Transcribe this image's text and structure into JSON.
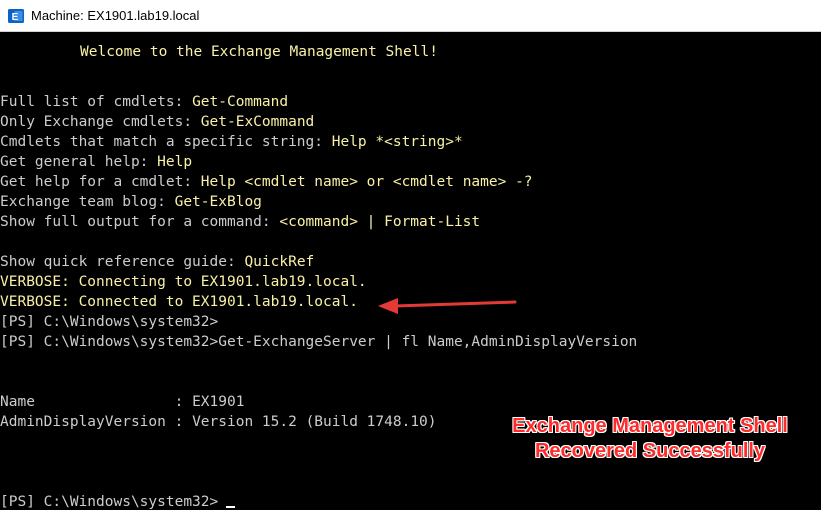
{
  "window": {
    "title": "Machine: EX1901.lab19.local",
    "icon": "exchange-shell-icon",
    "brand_color": "#0a64c8"
  },
  "console": {
    "welcome": "Welcome to the Exchange Management Shell!",
    "help_lines": [
      {
        "label": "Full list of cmdlets: ",
        "cmd": "Get-Command"
      },
      {
        "label": "Only Exchange cmdlets: ",
        "cmd": "Get-ExCommand"
      },
      {
        "label": "Cmdlets that match a specific string: ",
        "cmd": "Help *<string>*"
      },
      {
        "label": "Get general help: ",
        "cmd": "Help"
      },
      {
        "label": "Get help for a cmdlet: ",
        "cmd": "Help <cmdlet name> or <cmdlet name> -?"
      },
      {
        "label": "Exchange team blog: ",
        "cmd": "Get-ExBlog"
      },
      {
        "label": "Show full output for a command: ",
        "cmd": "<command> | Format-List"
      }
    ],
    "quickref": {
      "label": "Show quick reference guide: ",
      "cmd": "QuickRef"
    },
    "verbose_connecting": "VERBOSE: Connecting to EX1901.lab19.local.",
    "verbose_connected": "VERBOSE: Connected to EX1901.lab19.local.",
    "prompt": "[PS] C:\\Windows\\system32>",
    "command": "Get-ExchangeServer | fl Name,AdminDisplayVersion",
    "output": [
      {
        "key": "Name                ",
        "sep": ": ",
        "value": "EX1901"
      },
      {
        "key": "AdminDisplayVersion ",
        "sep": ": ",
        "value": "Version 15.2 (Build 1748.10)"
      }
    ]
  },
  "annotation": {
    "line1": "Exchange Management Shell",
    "line2": "Recovered Successfully",
    "color": "#ff2a2a"
  },
  "colors": {
    "console_bg": "#000000",
    "console_text": "#cccccc",
    "console_highlight": "#f9f1a5"
  }
}
